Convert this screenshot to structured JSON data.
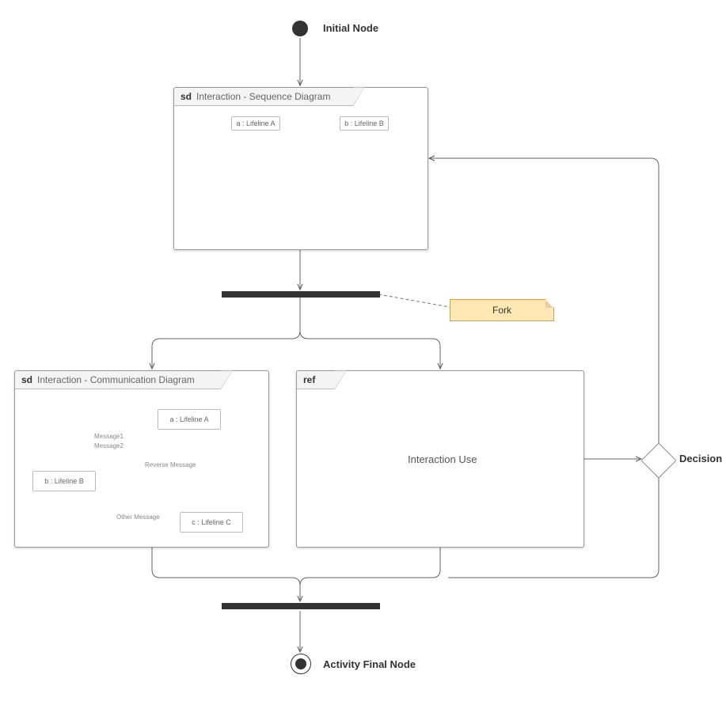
{
  "nodes": {
    "initial": "Initial Node",
    "final": "Activity Final Node",
    "decision": "Decision",
    "fork_note": "Fork"
  },
  "sequence_frame": {
    "prefix": "sd",
    "title": "Interaction - Sequence Diagram",
    "lifelines": {
      "a": "a : Lifeline A",
      "b": "b : Lifeline B"
    }
  },
  "communication_frame": {
    "prefix": "sd",
    "title": "Interaction - Communication Diagram",
    "lifelines": {
      "a": "a : Lifeline A",
      "b": "b : Lifeline B",
      "c": "c : Lifeline C"
    },
    "messages": {
      "m1": "Message1",
      "m2": "Message2",
      "reverse": "Reverse Message",
      "other": "Other Message"
    }
  },
  "interaction_use": {
    "prefix": "ref",
    "title": "Interaction Use"
  }
}
